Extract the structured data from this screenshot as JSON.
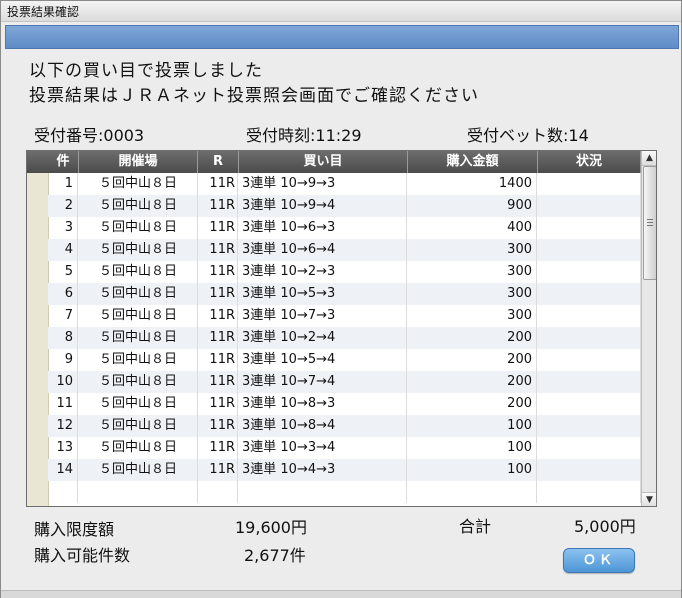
{
  "window": {
    "title": "投票結果確認"
  },
  "message": {
    "line1": "以下の買い目で投票しました",
    "line2": "投票結果はＪＲＡネット投票照会画面でご確認ください"
  },
  "info": {
    "receipt_number": "受付番号:0003",
    "receipt_time": "受付時刻:11:29",
    "bet_count": "受付ベット数:14"
  },
  "table": {
    "headers": [
      "件",
      "開催場",
      "R",
      "買い目",
      "購入金額",
      "状況"
    ],
    "rows": [
      {
        "no": "1",
        "venue": "５回中山８日",
        "race": "11R",
        "bet": "3連単 10→9→3",
        "amount": "1400",
        "status": ""
      },
      {
        "no": "2",
        "venue": "５回中山８日",
        "race": "11R",
        "bet": "3連単 10→9→4",
        "amount": "900",
        "status": ""
      },
      {
        "no": "3",
        "venue": "５回中山８日",
        "race": "11R",
        "bet": "3連単 10→6→3",
        "amount": "400",
        "status": ""
      },
      {
        "no": "4",
        "venue": "５回中山８日",
        "race": "11R",
        "bet": "3連単 10→6→4",
        "amount": "300",
        "status": ""
      },
      {
        "no": "5",
        "venue": "５回中山８日",
        "race": "11R",
        "bet": "3連単 10→2→3",
        "amount": "300",
        "status": ""
      },
      {
        "no": "6",
        "venue": "５回中山８日",
        "race": "11R",
        "bet": "3連単 10→5→3",
        "amount": "300",
        "status": ""
      },
      {
        "no": "7",
        "venue": "５回中山８日",
        "race": "11R",
        "bet": "3連単 10→7→3",
        "amount": "300",
        "status": ""
      },
      {
        "no": "8",
        "venue": "５回中山８日",
        "race": "11R",
        "bet": "3連単 10→2→4",
        "amount": "200",
        "status": ""
      },
      {
        "no": "9",
        "venue": "５回中山８日",
        "race": "11R",
        "bet": "3連単 10→5→4",
        "amount": "200",
        "status": ""
      },
      {
        "no": "10",
        "venue": "５回中山８日",
        "race": "11R",
        "bet": "3連単 10→7→4",
        "amount": "200",
        "status": ""
      },
      {
        "no": "11",
        "venue": "５回中山８日",
        "race": "11R",
        "bet": "3連単 10→8→3",
        "amount": "200",
        "status": ""
      },
      {
        "no": "12",
        "venue": "５回中山８日",
        "race": "11R",
        "bet": "3連単 10→8→4",
        "amount": "100",
        "status": ""
      },
      {
        "no": "13",
        "venue": "５回中山８日",
        "race": "11R",
        "bet": "3連単 10→3→4",
        "amount": "100",
        "status": ""
      },
      {
        "no": "14",
        "venue": "５回中山８日",
        "race": "11R",
        "bet": "3連単 10→4→3",
        "amount": "100",
        "status": ""
      },
      {
        "no": "",
        "venue": "",
        "race": "",
        "bet": "",
        "amount": "",
        "status": ""
      }
    ]
  },
  "footer": {
    "limit_label": "購入限度額",
    "limit_value": "19,600円",
    "count_label": "購入可能件数",
    "count_value": "2,677件",
    "total_label": "合計",
    "total_value": "5,000円",
    "ok_label": "ＯＫ"
  },
  "icons": {
    "scroll_up": "triangle-up",
    "scroll_down": "triangle-down"
  },
  "colors": {
    "header_bar": "#6f9ad0",
    "ok_button": "#5a9fdc",
    "table_header": "#555555"
  }
}
